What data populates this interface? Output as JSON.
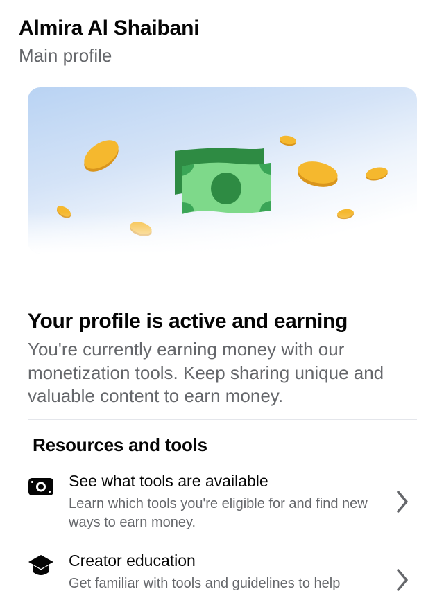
{
  "header": {
    "name": "Almira Al Shaibani",
    "subtitle": "Main profile"
  },
  "hero": {
    "illustration": "money-and-coins-illustration",
    "colors": {
      "sky": "#b9d3f3",
      "bill_dark": "#2e8b43",
      "bill_light": "#7ed98a",
      "coin": "#f5b82e"
    }
  },
  "status": {
    "title": "Your profile is active and earning",
    "description": "You're currently earning money with our monetization tools. Keep sharing unique and valuable content to earn money."
  },
  "resources": {
    "title": "Resources and tools",
    "items": [
      {
        "icon": "money-bill-icon",
        "title": "See what tools are available",
        "description": "Learn which tools you're eligible for and find new ways to earn money."
      },
      {
        "icon": "graduation-cap-icon",
        "title": "Creator education",
        "description": "Get familiar with tools and guidelines to help"
      }
    ]
  }
}
